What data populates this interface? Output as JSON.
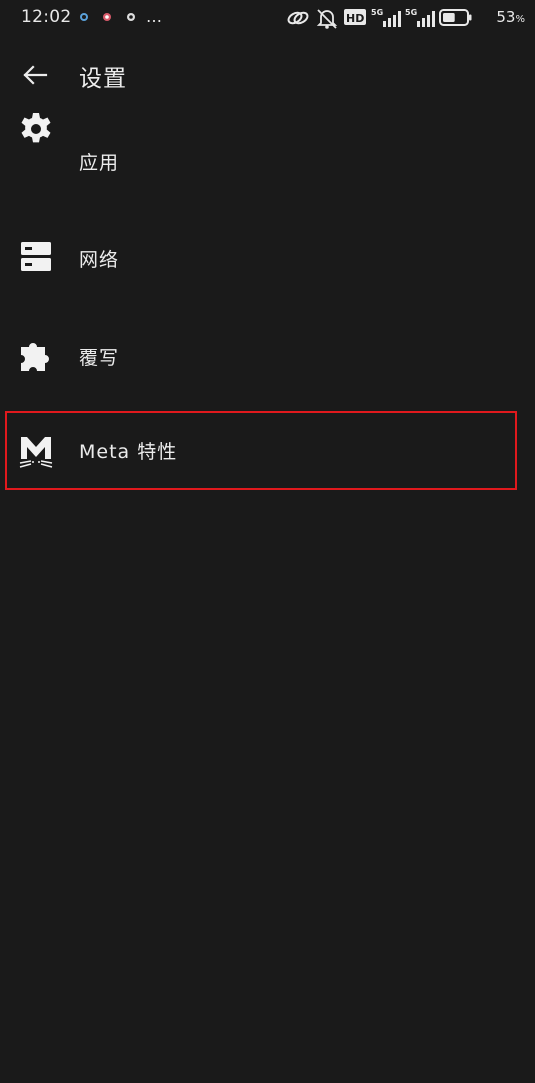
{
  "status_bar": {
    "time": "12:02",
    "more_indicator": "…",
    "network_type_1": "5G",
    "network_type_2": "5G",
    "hd_label": "HD",
    "battery_percent": "53",
    "battery_unit": "%",
    "battery_level": 0.53
  },
  "app_bar": {
    "title": "设置"
  },
  "settings": {
    "items": [
      {
        "label": "应用",
        "icon": "gear-icon"
      },
      {
        "label": "网络",
        "icon": "server-icon"
      },
      {
        "label": "覆写",
        "icon": "puzzle-icon"
      },
      {
        "label": "Meta 特性",
        "icon": "meta-cat-icon"
      }
    ]
  },
  "colors": {
    "background": "#1a1a1a",
    "text": "#ececec",
    "highlight_border": "#e0191d"
  }
}
